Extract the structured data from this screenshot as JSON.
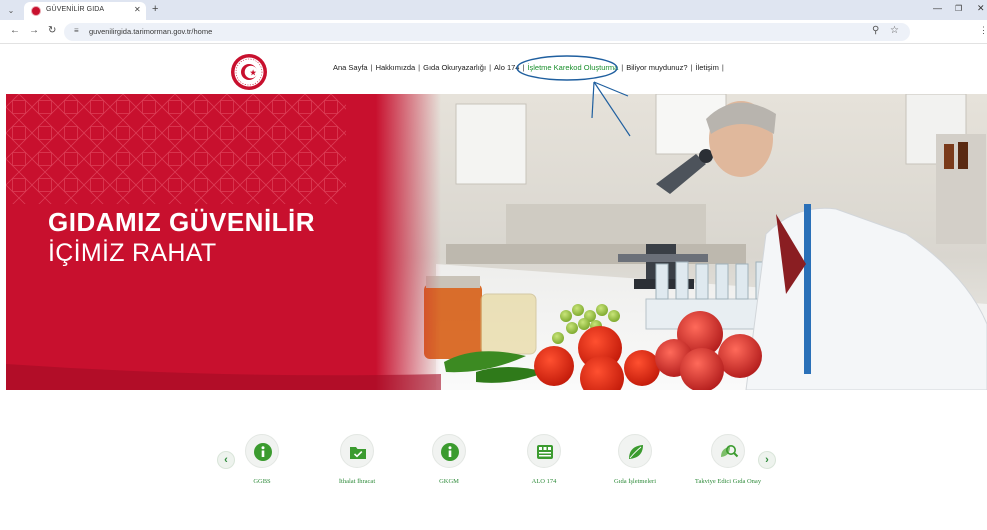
{
  "browser": {
    "tab_title": "GÜVENİLİR GIDA",
    "url": "guvenilirgida.tarimorman.gov.tr/home"
  },
  "header": {
    "nav": [
      {
        "label": "Ana Sayfa",
        "active": false
      },
      {
        "label": "Hakkımızda",
        "active": false
      },
      {
        "label": "Gıda Okuryazarlığı",
        "active": false
      },
      {
        "label": "Alo 174",
        "active": false
      },
      {
        "label": "İşletme Karekod Oluşturma",
        "active": true
      },
      {
        "label": "Biliyor muydunuz?",
        "active": false
      },
      {
        "label": "İletişim",
        "active": false
      }
    ]
  },
  "hero": {
    "title": "GIDAMIZ GÜVENİLİR",
    "subtitle": "İÇİMİZ RAHAT"
  },
  "carousel": {
    "items": [
      {
        "label": "GGBS",
        "icon": "info-icon"
      },
      {
        "label": "İthalat İhracat",
        "icon": "folder-check-icon"
      },
      {
        "label": "GKGM",
        "icon": "info-icon"
      },
      {
        "label": "ALO 174",
        "icon": "alo174-icon"
      },
      {
        "label": "Gıda İşletmeleri",
        "icon": "leaf-icon"
      },
      {
        "label": "Takviye Edici Gıda Onay",
        "icon": "leaf-search-icon"
      }
    ]
  },
  "colors": {
    "brand_red": "#c8102e",
    "accent_green": "#2e8b3a",
    "annotation_blue": "#1f5f9f"
  }
}
